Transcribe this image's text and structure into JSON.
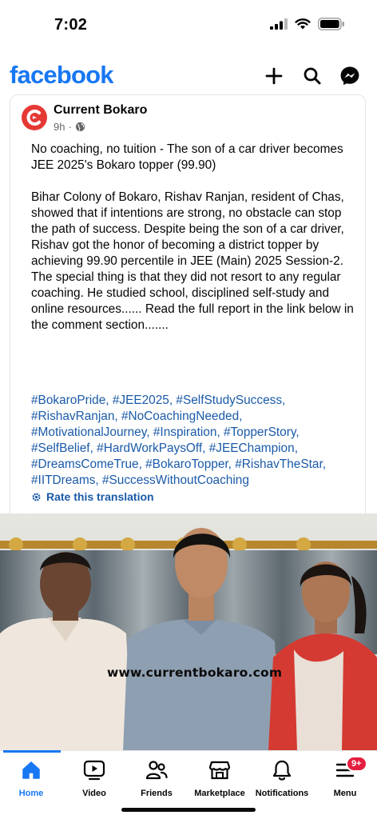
{
  "status_bar": {
    "time": "7:02"
  },
  "header": {
    "logo": "facebook",
    "actions": [
      {
        "name": "create",
        "icon": "plus-icon"
      },
      {
        "name": "search",
        "icon": "search-icon"
      },
      {
        "name": "messenger",
        "icon": "messenger-icon"
      }
    ]
  },
  "post": {
    "page_name": "Current Bokaro",
    "avatar_letter": "C",
    "time_ago": "9h",
    "separator": "·",
    "headline": "No coaching, no tuition - The son of a car driver becomes JEE 2025's Bokaro topper (99.90)",
    "body": "Bihar Colony of Bokaro, Rishav Ranjan, resident of Chas, showed that if intentions are strong, no obstacle can stop the path of success. Despite being the son of a car driver, Rishav got the honor of becoming a district topper by achieving 99.90 percentile in JEE (Main) 2025 Session-2. The special thing is that they did not resort to any regular coaching. He studied school, disciplined self-study and online resources...... Read the full report in the link below in the comment section.......",
    "hashtags": [
      "#BokaroPride",
      "#JEE2025",
      "#SelfStudySuccess",
      "#RishavRanjan",
      "#NoCoachingNeeded",
      "#MotivationalJourney",
      "#Inspiration",
      "#TopperStory",
      "#SelfBelief",
      "#HardWorkPaysOff",
      "#JEEChampion",
      "#DreamsComeTrue",
      "#BokaroTopper",
      "#RishavTheStar",
      "#IITDreams",
      "#SuccessWithoutCoaching"
    ],
    "translate_label": "Rate this translation",
    "photo_watermark": "www.currentbokaro.com"
  },
  "tabs": [
    {
      "label": "Home",
      "icon": "home-icon",
      "active": true
    },
    {
      "label": "Video",
      "icon": "video-icon"
    },
    {
      "label": "Friends",
      "icon": "friends-icon"
    },
    {
      "label": "Marketplace",
      "icon": "marketplace-icon"
    },
    {
      "label": "Notifications",
      "icon": "bell-icon"
    },
    {
      "label": "Menu",
      "icon": "menu-icon",
      "badge": "9+"
    }
  ],
  "colors": {
    "brand": "#1877f2",
    "hashtag": "#1a5aa8",
    "badge": "#e41e3f",
    "avatar": "#e53935"
  }
}
